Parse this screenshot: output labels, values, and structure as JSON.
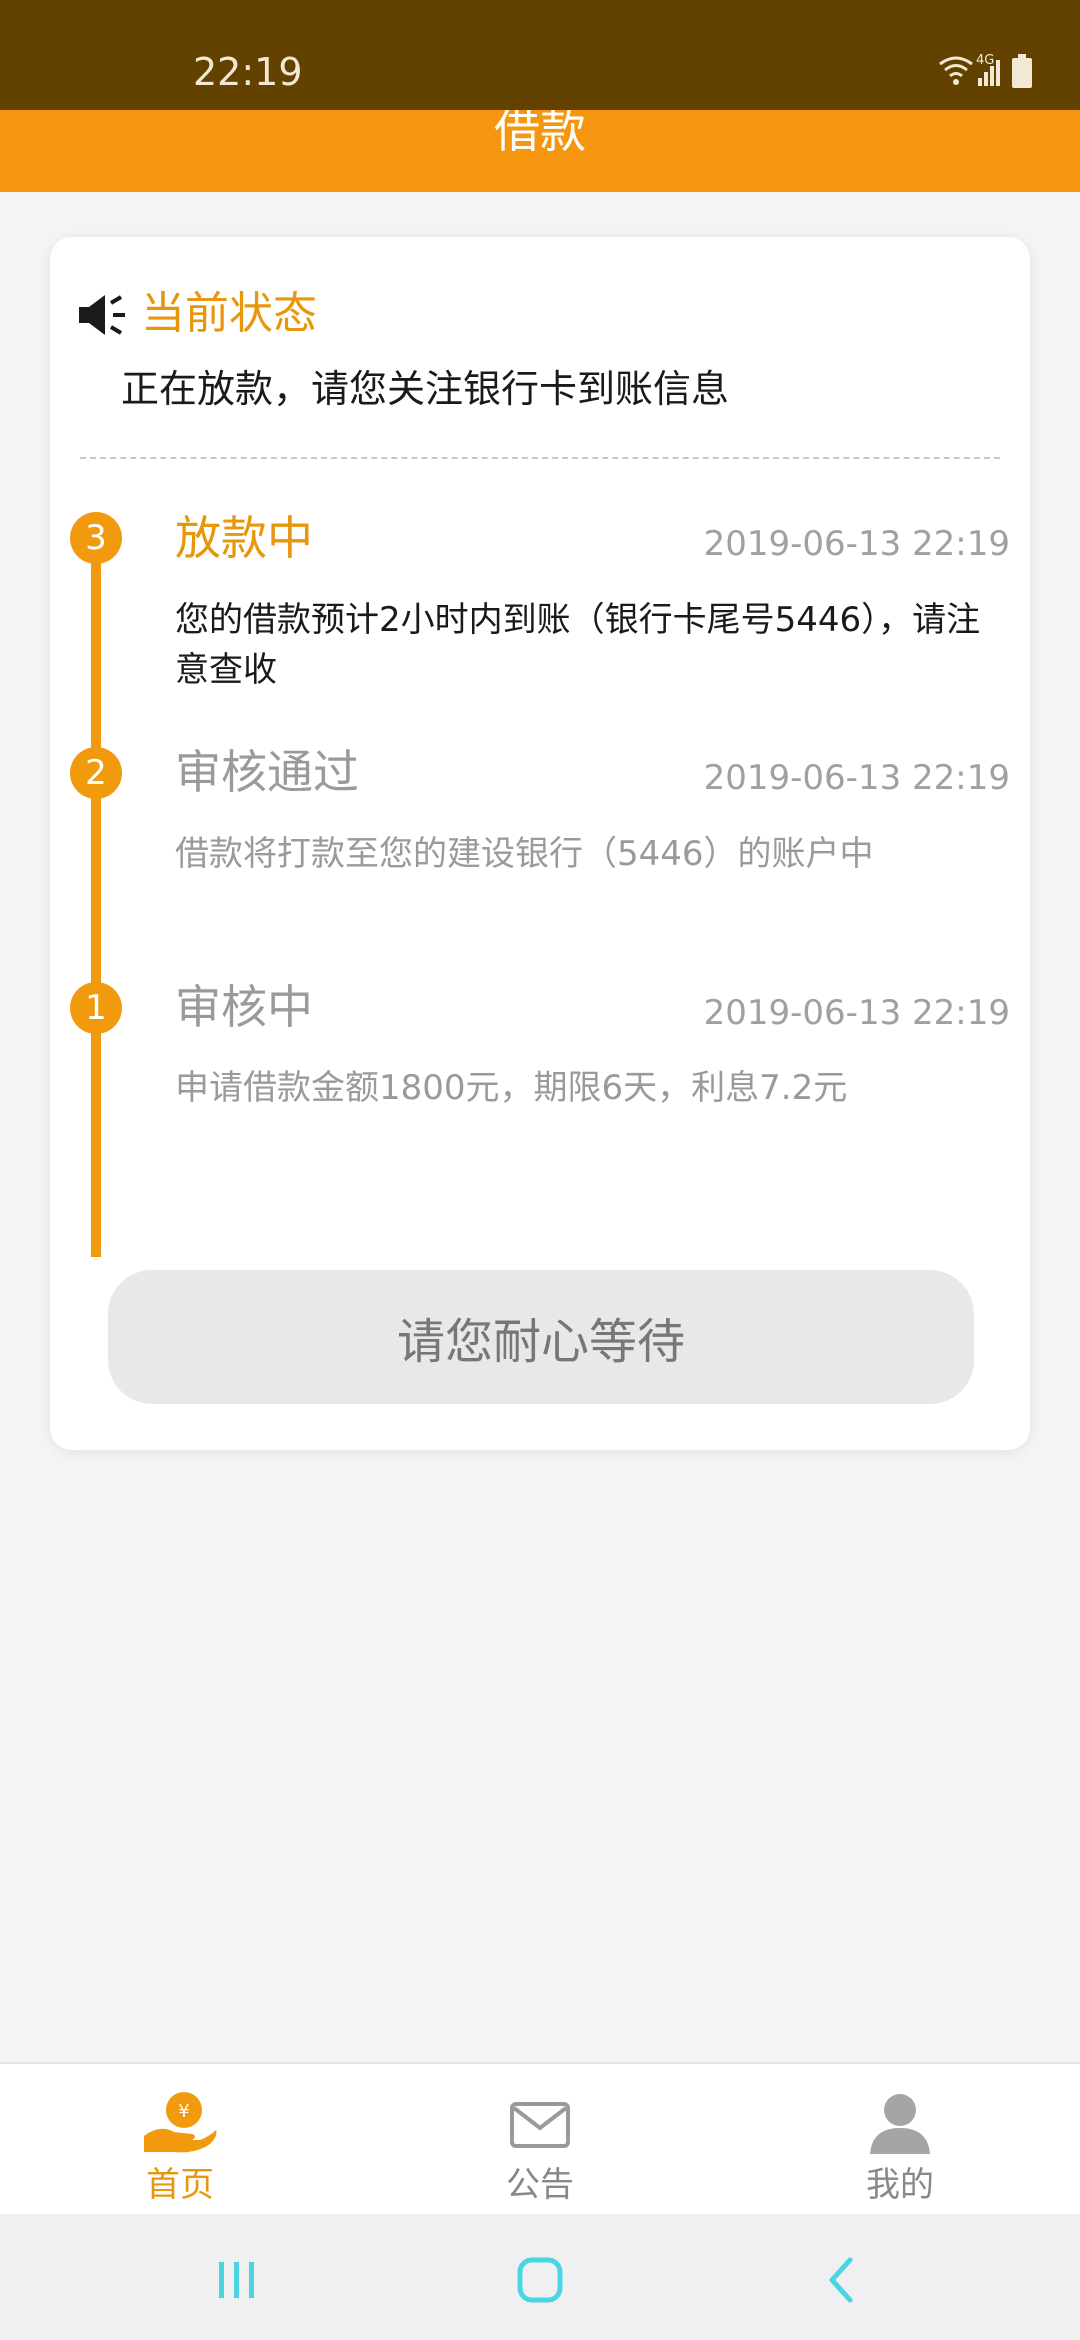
{
  "status_bar": {
    "time": "22:19",
    "network": "4G"
  },
  "header": {
    "title": "借款"
  },
  "status_card": {
    "heading": "当前状态",
    "message": "正在放款，请您关注银行卡到账信息"
  },
  "timeline": [
    {
      "number": "3",
      "title": "放款中",
      "date": "2019-06-13 22:19",
      "description": "您的借款预计2小时内到账（银行卡尾号5446），请注意查收",
      "active": true
    },
    {
      "number": "2",
      "title": "审核通过",
      "date": "2019-06-13 22:19",
      "description": "借款将打款至您的建设银行（5446）的账户中",
      "active": false
    },
    {
      "number": "1",
      "title": "审核中",
      "date": "2019-06-13 22:19",
      "description": "申请借款金额1800元，期限6天，利息7.2元",
      "active": false
    }
  ],
  "action": {
    "button_label": "请您耐心等待"
  },
  "bottom_nav": [
    {
      "label": "首页",
      "icon": "coin-hand-icon",
      "active": true
    },
    {
      "label": "公告",
      "icon": "envelope-icon",
      "active": false
    },
    {
      "label": "我的",
      "icon": "person-icon",
      "active": false
    }
  ],
  "colors": {
    "accent": "#f29a0d",
    "header_dark": "#634200",
    "inactive_text": "#9a9a9a",
    "system_nav": "#4ad6e0"
  }
}
